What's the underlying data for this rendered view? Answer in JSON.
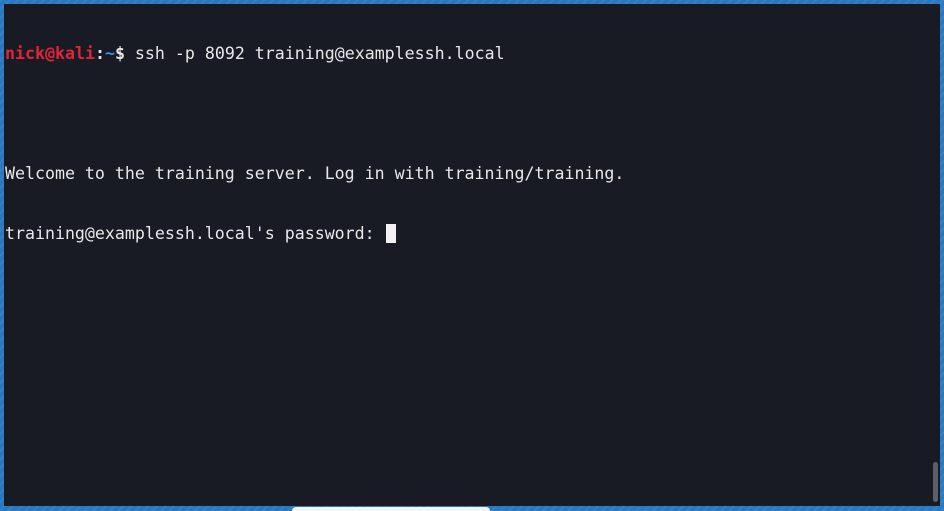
{
  "prompt": {
    "user": "nick",
    "at": "@",
    "host": "kali",
    "colon": ":",
    "path": "~",
    "symbol": "$",
    "command": " ssh -p 8092 training@examplessh.local"
  },
  "output": {
    "blank": "",
    "welcome": "Welcome to the training server. Log in with training/training.",
    "password_prompt": "training@examplessh.local's password: "
  },
  "colors": {
    "terminal_bg": "#191b24",
    "prompt_user": "#e0243a",
    "prompt_path": "#3b8eea",
    "text": "#e8e8e8",
    "desktop_bg": "#2a78c0"
  }
}
